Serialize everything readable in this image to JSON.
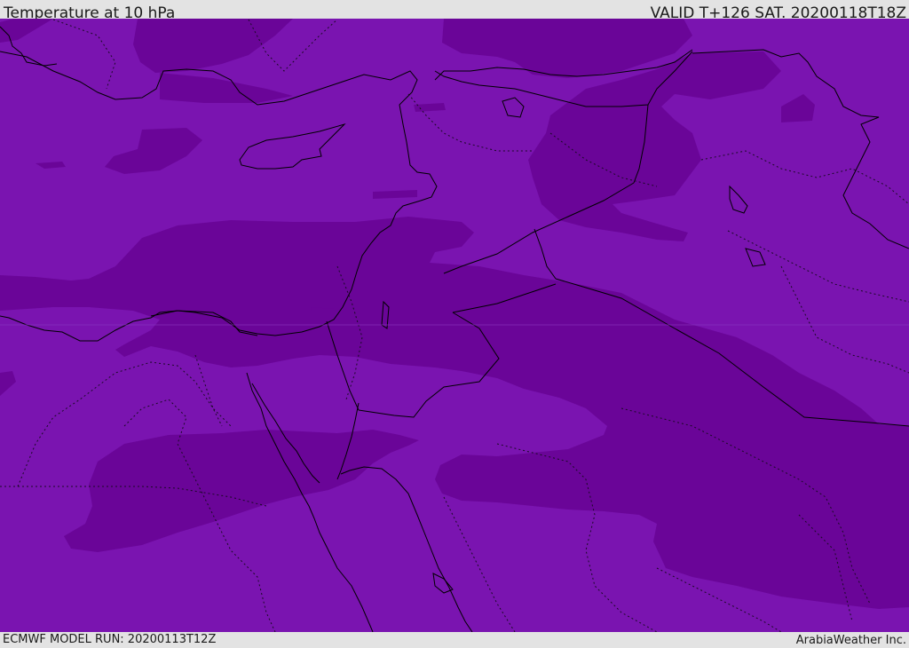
{
  "header": {
    "title": "Temperature at 10 hPa",
    "valid": "VALID T+126 SAT. 20200118T18Z"
  },
  "footer": {
    "model_run": "ECMWF MODEL RUN: 20200113T12Z",
    "credit": "ArabiaWeather Inc."
  },
  "map": {
    "colors": {
      "background_band": "#7a14b0",
      "darker_band": "#6a0598",
      "darkest_band": "#5c0088",
      "coastline": "#000000",
      "border": "#000000"
    }
  }
}
